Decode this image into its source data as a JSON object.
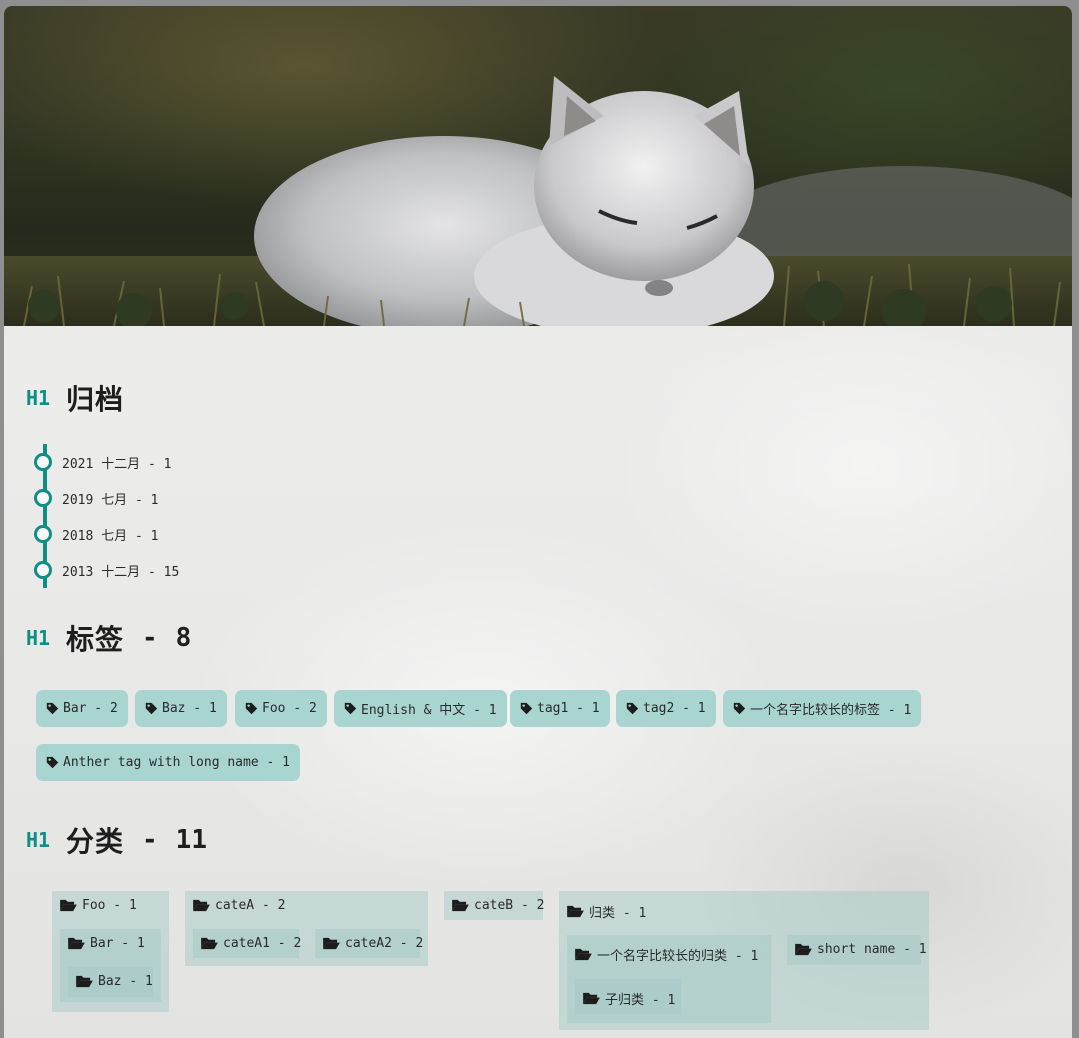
{
  "hero": {
    "image": "arctic-fox-sleeping-photo"
  },
  "sections": {
    "archive": {
      "mark": "H1",
      "title": "归档"
    },
    "tags": {
      "mark": "H1",
      "title": "标签",
      "count": "8"
    },
    "categories": {
      "mark": "H1",
      "title": "分类",
      "count": "11"
    }
  },
  "archive_items": [
    {
      "label": "2021 十二月 - 1"
    },
    {
      "label": "2019 七月 - 1"
    },
    {
      "label": "2018 七月 - 1"
    },
    {
      "label": "2013 十二月 - 15"
    }
  ],
  "tags": [
    {
      "label": "Bar - 2"
    },
    {
      "label": "Baz - 1"
    },
    {
      "label": "Foo - 2"
    },
    {
      "label": "English & 中文 - 1"
    },
    {
      "label": "tag1 - 1"
    },
    {
      "label": "tag2 - 1"
    },
    {
      "label": "一个名字比较长的标签 - 1"
    },
    {
      "label": "Anther tag with long name - 1"
    }
  ],
  "categories": {
    "foo": "Foo - 1",
    "bar": "Bar - 1",
    "baz": "Baz - 1",
    "cateA": "cateA - 2",
    "cateA1": "cateA1 - 2",
    "cateA2": "cateA2 - 2",
    "cateB": "cateB - 2",
    "guilei": "归类 - 1",
    "long_cat": "一个名字比较长的归类 - 1",
    "sub_cat": "子归类 - 1",
    "short_name": "short name - 1"
  },
  "colors": {
    "accent": "#0e8e85",
    "tag_bg": "#a8d5d0",
    "category_bg": "#c3dcd9"
  },
  "icons": {
    "tag": "tag-icon",
    "category": "folder-open-icon",
    "timeline": "timeline-dot-icon"
  }
}
